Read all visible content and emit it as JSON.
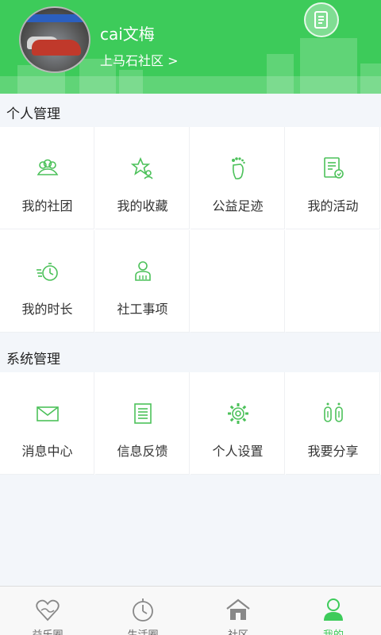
{
  "profile": {
    "name": "cai文梅",
    "community": "上马石社区  >"
  },
  "personal": {
    "title": "个人管理",
    "items": [
      {
        "label": "我的社团",
        "icon": "group-icon"
      },
      {
        "label": "我的收藏",
        "icon": "star-collection-icon"
      },
      {
        "label": "公益足迹",
        "icon": "footprint-icon"
      },
      {
        "label": "我的活动",
        "icon": "activity-list-icon"
      },
      {
        "label": "我的时长",
        "icon": "stopwatch-icon"
      },
      {
        "label": "社工事项",
        "icon": "social-worker-icon"
      }
    ]
  },
  "system": {
    "title": "系统管理",
    "items": [
      {
        "label": "消息中心",
        "icon": "envelope-icon"
      },
      {
        "label": "信息反馈",
        "icon": "document-icon"
      },
      {
        "label": "个人设置",
        "icon": "gear-icon"
      },
      {
        "label": "我要分享",
        "icon": "share-icon"
      }
    ]
  },
  "nav": {
    "items": [
      {
        "label": "益乐圈",
        "icon": "heart-hands-icon"
      },
      {
        "label": "生活圈",
        "icon": "clock-icon"
      },
      {
        "label": "社区",
        "icon": "house-icon"
      },
      {
        "label": "我的",
        "icon": "person-icon"
      }
    ],
    "active_index": 3
  },
  "colors": {
    "accent": "#3dcb5a",
    "icon_green": "#4cc15a",
    "background": "#f3f6fa"
  }
}
